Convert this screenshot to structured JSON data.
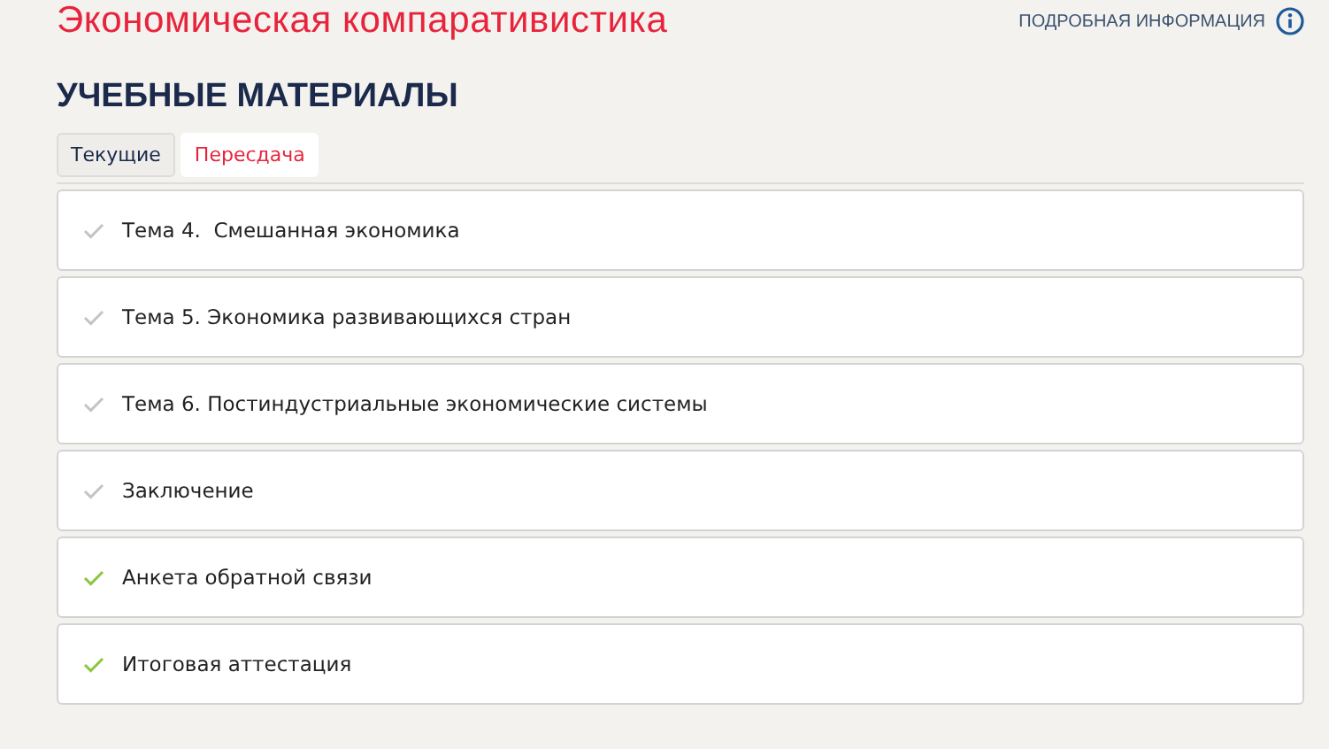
{
  "course_title": "Экономическая компаративистика",
  "info_link": "ПОДРОБНАЯ ИНФОРМАЦИЯ",
  "section_title": "УЧЕБНЫЕ МАТЕРИАЛЫ",
  "tabs": [
    {
      "label": "Текущие",
      "selected": false
    },
    {
      "label": "Пересдача",
      "selected": true
    }
  ],
  "items": [
    {
      "title": "Тема 4.  Смешанная экономика",
      "completed": false
    },
    {
      "title": "Тема 5. Экономика развивающихся стран",
      "completed": false
    },
    {
      "title": "Тема 6. Постиндустриальные экономические системы",
      "completed": false
    },
    {
      "title": "Заключение",
      "completed": false
    },
    {
      "title": "Анкета обратной связи",
      "completed": true
    },
    {
      "title": "Итоговая аттестация",
      "completed": true
    }
  ]
}
